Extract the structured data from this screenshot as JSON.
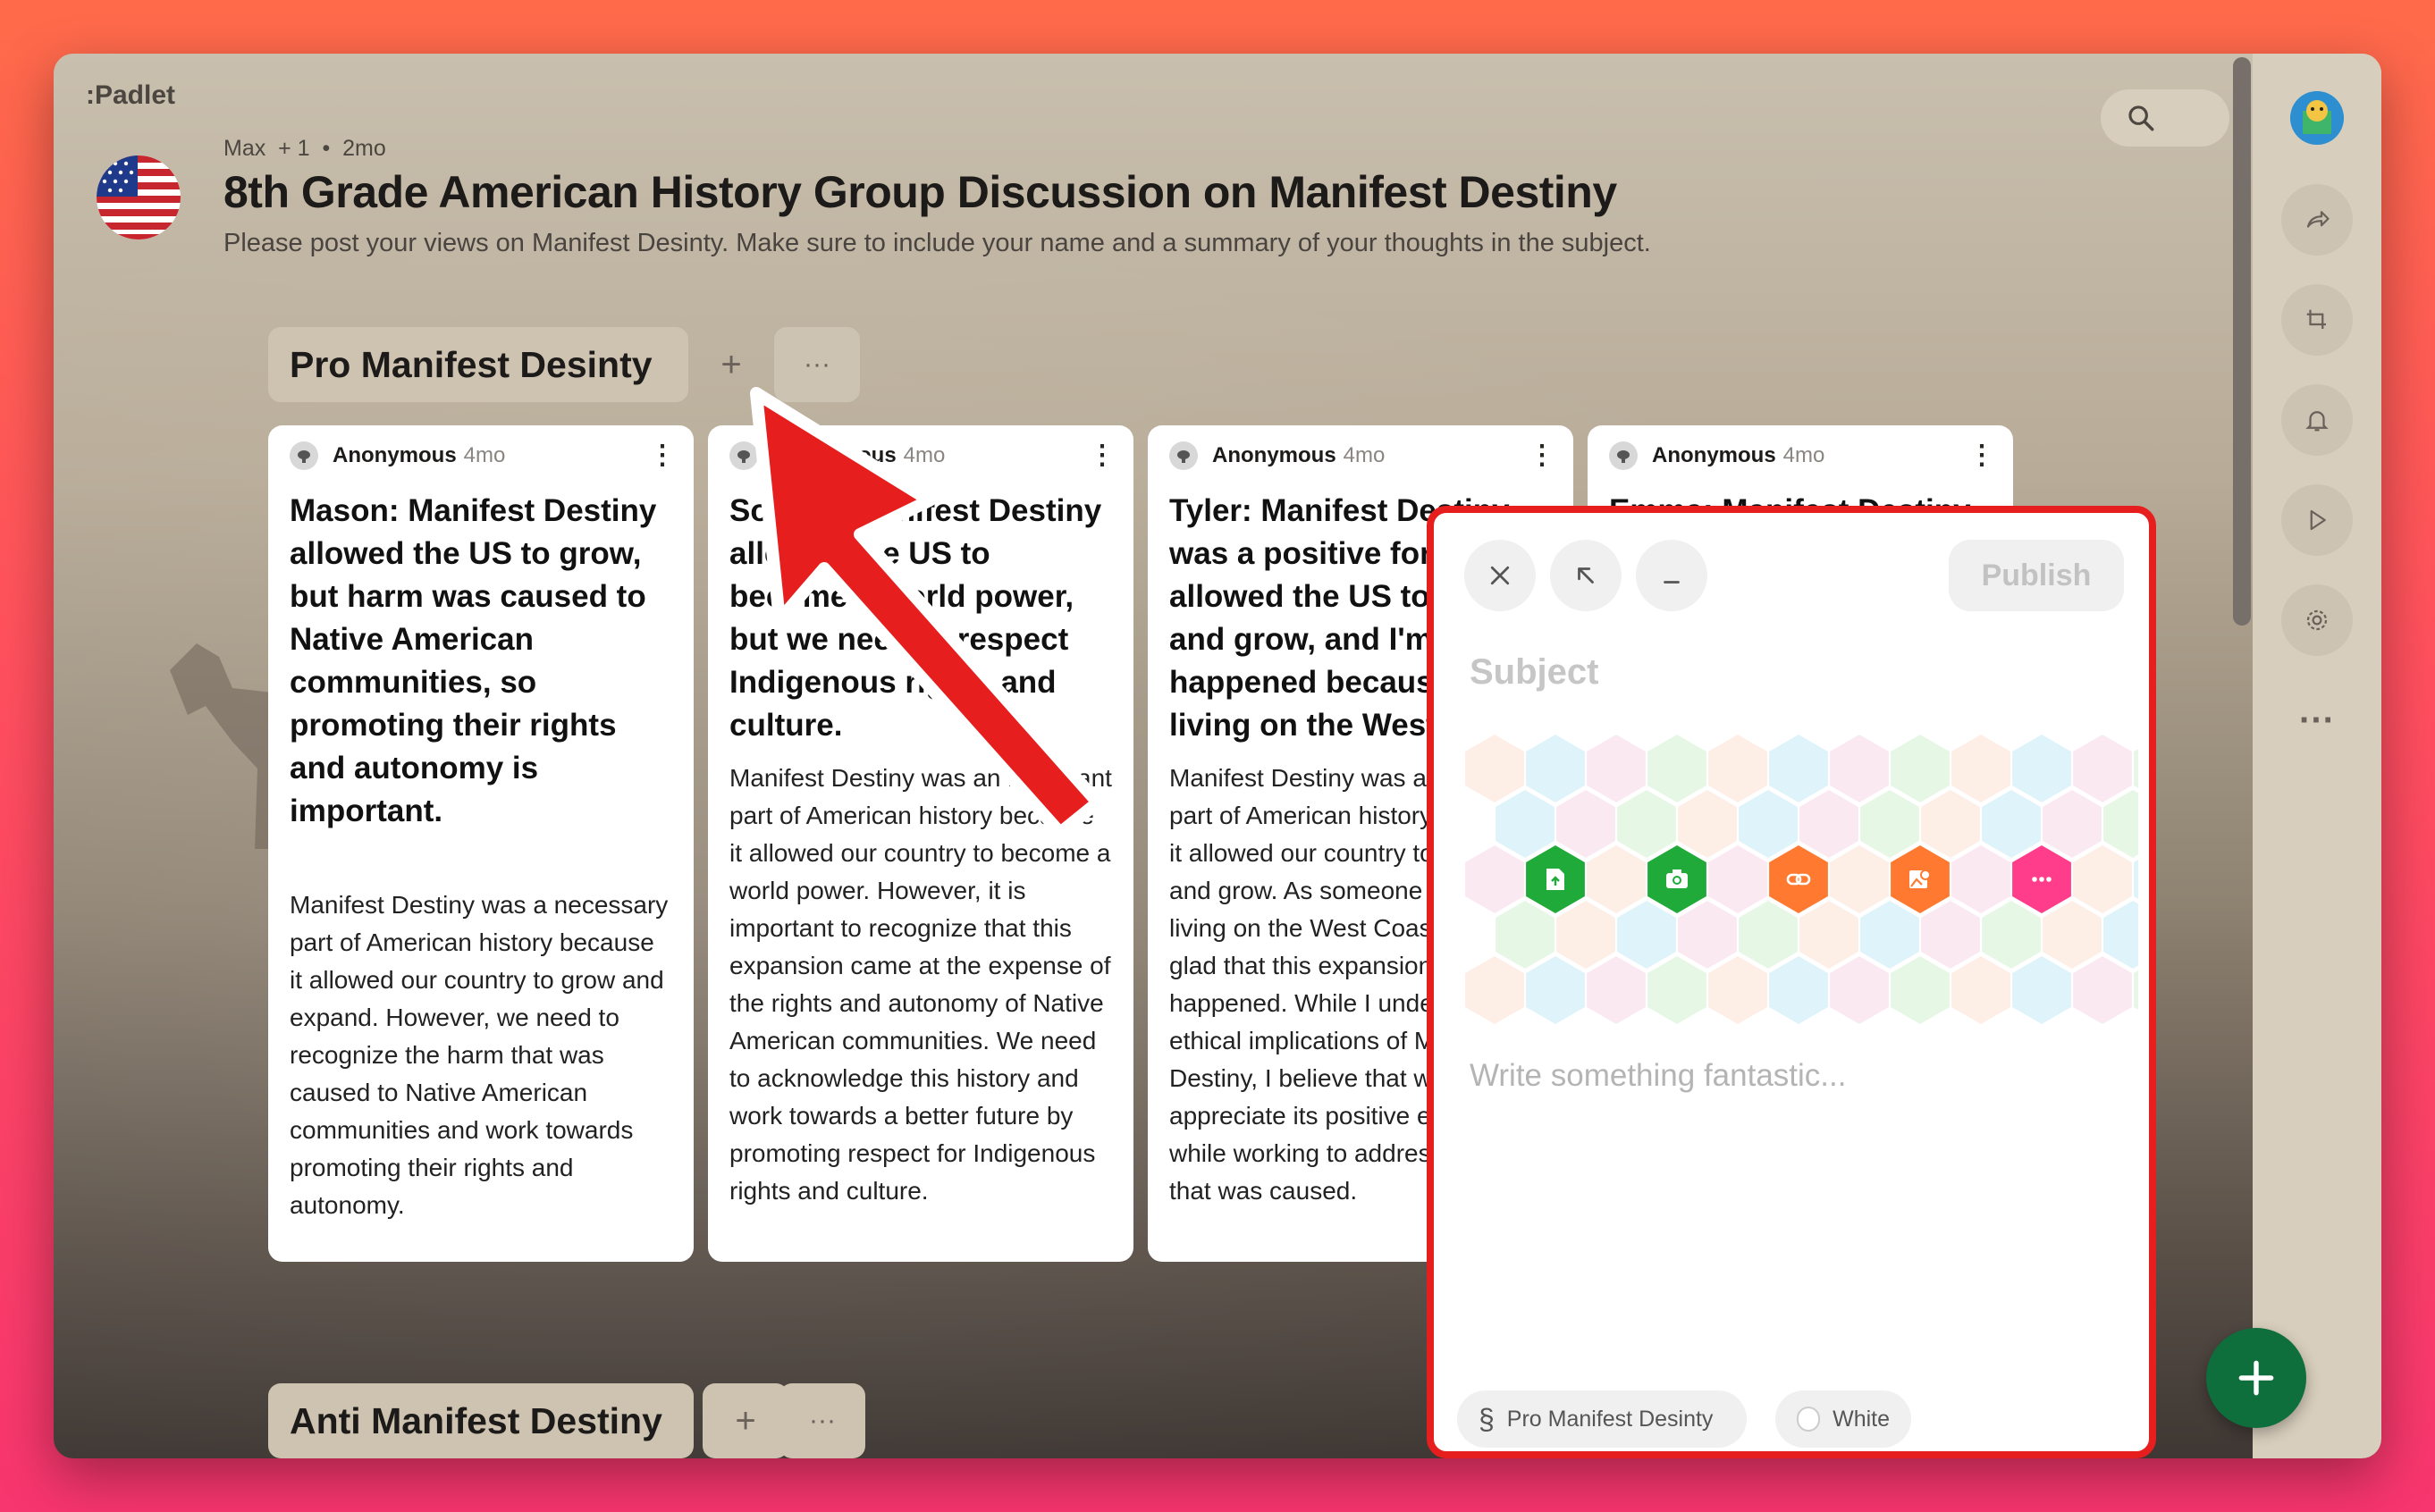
{
  "app": {
    "logo": ":Padlet"
  },
  "board": {
    "meta": "Max  + 1  •  2mo",
    "title": "8th Grade American History Group Discussion on Manifest Destiny",
    "description": "Please post your views on Manifest Desinty. Make sure to include your name and a summary of your thoughts in the subject."
  },
  "sections": [
    {
      "title": "Pro Manifest Desinty",
      "add": "+",
      "more": "···"
    },
    {
      "title": "Anti Manifest Destiny",
      "add": "+",
      "more": "···"
    }
  ],
  "cards": [
    {
      "author": "Anonymous",
      "time": "4mo",
      "subject": "Mason: Manifest Destiny allowed the US to grow, but harm was caused to Native American communities, so promoting their rights and autonomy is important.",
      "body": "Manifest Destiny was a necessary part of American history because it allowed our country to grow and expand. However, we need to recognize the harm that was caused to Native American communities and work towards promoting their rights and autonomy."
    },
    {
      "author": "Anonymous",
      "time": "4mo",
      "subject": "Sophia: Manifest Destiny allowed the US to become a world power, but we need to respect Indigenous rights and culture.",
      "body": "Manifest Destiny was an important part of American history because it allowed our country to become a world power. However, it is important to recognize that this expansion came at the expense of the rights and autonomy of Native American communities. We need to acknowledge this history and work towards a better future by promoting respect for Indigenous rights and culture."
    },
    {
      "author": "Anonymous",
      "time": "4mo",
      "subject": "Tyler: Manifest Destiny was a positive force that allowed the US to expand and grow, and I'm glad it happened because I love living on the West Coast.",
      "body": "Manifest Destiny was an important part of American history because it allowed our country to expand and grow. As someone who loves living on the West Coast, I am glad that this expansion happened. While I understand the ethical implications of Manifest Destiny, I believe that we can appreciate its positive effects while working to address the harm that was caused."
    },
    {
      "author": "Anonymous",
      "time": "4mo",
      "subject": "Emma: Manifest Destiny",
      "body": ""
    }
  ],
  "composer": {
    "publish": "Publish",
    "subject_placeholder": "Subject",
    "body_placeholder": "Write something fantastic...",
    "section_chip": "Pro Manifest Desinty",
    "section_icon": "§",
    "color_chip": "White",
    "attachments": [
      {
        "icon": "upload-file-icon",
        "color": "#1faa3a"
      },
      {
        "icon": "camera-icon",
        "color": "#1faa3a"
      },
      {
        "icon": "link-icon",
        "color": "#ff7a30"
      },
      {
        "icon": "image-search-icon",
        "color": "#ff7a30"
      },
      {
        "icon": "more-options-icon",
        "color": "#ff3d8a"
      }
    ]
  },
  "colors": {
    "annotation": "#e61e1e",
    "fab": "#0e6e3c"
  }
}
